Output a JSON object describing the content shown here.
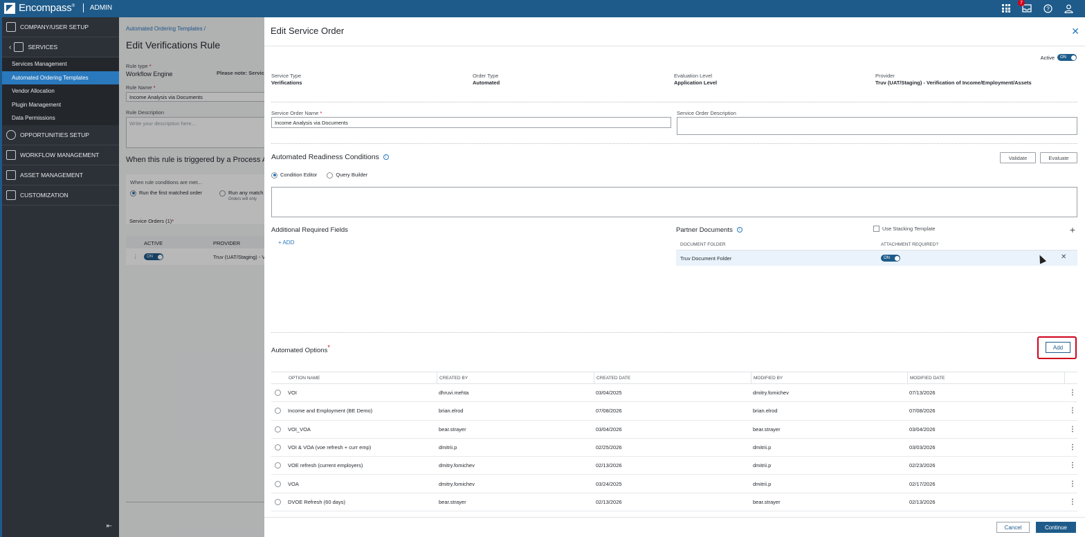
{
  "topbar": {
    "brand": "Encompass",
    "brand_mark": "®",
    "section": "ADMIN",
    "notification_count": "7"
  },
  "sidebar": {
    "top_item": "COMPANY/USER SETUP",
    "services": "SERVICES",
    "sub_items": [
      "Services Management",
      "Automated Ordering Templates",
      "Vendor Allocation",
      "Plugin Management",
      "Data Permissions"
    ],
    "items_after": [
      "OPPORTUNITIES SETUP",
      "WORKFLOW MANAGEMENT",
      "ASSET MANAGEMENT",
      "CUSTOMIZATION"
    ]
  },
  "background_page": {
    "breadcrumb": "Automated Ordering Templates /",
    "title": "Edit Verifications Rule",
    "rule_type_label": "Rule type",
    "rule_type_value": "Workflow Engine",
    "please_note": "Please note: Servic",
    "rule_name_label": "Rule Name",
    "rule_name_value": "Income Analysis via Documents",
    "rule_desc_label": "Rule Description",
    "rule_desc_placeholder": "Write your description here...",
    "trigger_text": "When this rule is triggered by a Process A",
    "conditions_met": "When rule conditions are met...",
    "radio_first": "Run the first matched order",
    "radio_any": "Run any match",
    "radio_any_sub": "Orders will only",
    "service_orders": "Service Orders (1)",
    "col_active": "ACTIVE",
    "col_provider": "PROVIDER",
    "row_toggle": "ON",
    "row_provider": "Truv (UAT/Staging) - V"
  },
  "modal": {
    "title": "Edit Service Order",
    "active_label": "Active",
    "active_toggle": "ON",
    "info": [
      {
        "label": "Service Type",
        "value": "Verifications"
      },
      {
        "label": "Order Type",
        "value": "Automated"
      },
      {
        "label": "Evaluation Level",
        "value": "Application Level"
      },
      {
        "label": "Provider",
        "value": "Truv (UAT/Staging) - Verification of Income/Employment/Assets"
      }
    ],
    "service_order_name_label": "Service Order Name",
    "service_order_name_value": "Income Analysis via Documents",
    "service_order_desc_label": "Service Order Description",
    "readiness_title": "Automated Readiness Conditions",
    "validate": "Validate",
    "evaluate": "Evaluate",
    "radio_condition_editor": "Condition Editor",
    "radio_query_builder": "Query Builder",
    "additional_fields_title": "Additional Required Fields",
    "add_link": "+ ADD",
    "partner_docs_title": "Partner Documents",
    "use_stacking": "Use Stacking Template",
    "pd_col_folder": "DOCUMENT FOLDER",
    "pd_col_attach": "ATTACHMENT REQUIRED?",
    "pd_row_folder": "Truv Document Folder",
    "pd_row_toggle": "ON",
    "automated_options_title": "Automated Options",
    "add_button": "Add",
    "columns": [
      "OPTION NAME",
      "CREATED BY",
      "CREATED DATE",
      "MODIFIED BY",
      "MODIFIED DATE"
    ],
    "rows": [
      {
        "name": "VOI",
        "created_by": "dhruvi.mehta",
        "created_date": "03/04/2025",
        "modified_by": "dmitry.fomichev",
        "modified_date": "07/13/2026"
      },
      {
        "name": "Income and Employment (BE Demo)",
        "created_by": "brian.elrod",
        "created_date": "07/08/2026",
        "modified_by": "brian.elrod",
        "modified_date": "07/08/2026"
      },
      {
        "name": "VOI_VOA",
        "created_by": "bear.strayer",
        "created_date": "03/04/2026",
        "modified_by": "bear.strayer",
        "modified_date": "03/04/2026"
      },
      {
        "name": "VOI & VOA (voe refresh + curr emp)",
        "created_by": "dmitrii.p",
        "created_date": "02/25/2026",
        "modified_by": "dmitrii.p",
        "modified_date": "03/03/2026"
      },
      {
        "name": "VOE refresh (current employers)",
        "created_by": "dmitry.fomichev",
        "created_date": "02/13/2026",
        "modified_by": "dmitrii.p",
        "modified_date": "02/23/2026"
      },
      {
        "name": "VOA",
        "created_by": "dmitry.fomichev",
        "created_date": "03/24/2025",
        "modified_by": "dmitrii.p",
        "modified_date": "02/17/2026"
      },
      {
        "name": "DVOE Refresh (60 days)",
        "created_by": "bear.strayer",
        "created_date": "02/13/2026",
        "modified_by": "bear.strayer",
        "modified_date": "02/13/2026"
      }
    ],
    "cancel": "Cancel",
    "continue": "Continue"
  },
  "colors": {
    "topbar": "#1e5b8a",
    "sidebar": "#2c3137",
    "active_nav": "#2a79bd",
    "highlight": "#d0021b"
  }
}
